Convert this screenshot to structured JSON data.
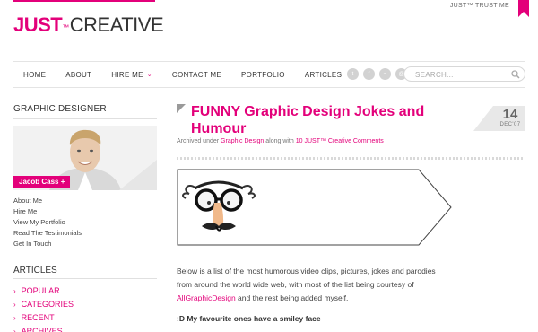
{
  "brand": {
    "logo_main": "JUST",
    "logo_tm": "™",
    "logo_rest": "CREATIVE",
    "trust_text": "JUST™ TRUST ME",
    "accent_color": "#e3007a"
  },
  "nav": {
    "items": [
      {
        "label": "HOME"
      },
      {
        "label": "ABOUT"
      },
      {
        "label": "HIRE ME",
        "dropdown": true
      },
      {
        "label": "CONTACT ME"
      },
      {
        "label": "PORTFOLIO"
      },
      {
        "label": "ARTICLES"
      }
    ],
    "social_icons": [
      "twitter-icon",
      "facebook-icon",
      "rss-icon",
      "email-icon"
    ],
    "search_placeholder": "SEARCH..."
  },
  "sidebar": {
    "title": "GRAPHIC DESIGNER",
    "profile_name": "Jacob Cass +",
    "links": [
      {
        "label": "About Me"
      },
      {
        "label": "Hire Me"
      },
      {
        "label": "View My Portfolio"
      },
      {
        "label": "Read The Testimonials"
      },
      {
        "label": "Get In Touch"
      }
    ],
    "articles_title": "ARTICLES",
    "articles": [
      {
        "label": "POPULAR"
      },
      {
        "label": "CATEGORIES"
      },
      {
        "label": "RECENT"
      },
      {
        "label": "ARCHIVES"
      }
    ]
  },
  "post": {
    "title": "FUNNY Graphic Design Jokes and Humour",
    "meta_prefix": "Archived under",
    "meta_category": "Graphic Design",
    "meta_middle": "along with",
    "meta_comments": "10 JUST™ Creative Comments",
    "date_day": "14",
    "date_month": "DEC'07",
    "intro_1": "Below is a list of the most humorous video clips, pictures, jokes and parodies from around the world wide web, with most of the list being courtesy of",
    "intro_link": "AllGraphicDesign",
    "intro_2": "and the rest being added myself.",
    "smiley_note": ":D My favourite ones have a smiley face"
  }
}
